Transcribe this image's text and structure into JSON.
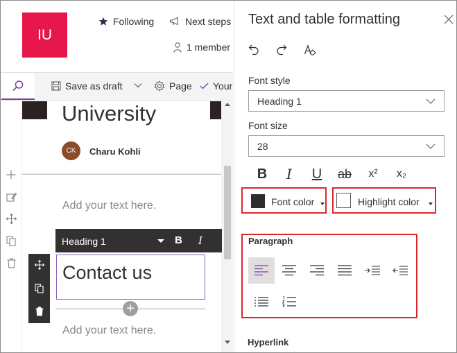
{
  "site": {
    "logo_initials": "IU",
    "following_label": "Following",
    "next_steps_label": "Next steps",
    "members_label": "1 member"
  },
  "commandbar": {
    "save_as_draft_label": "Save as draft",
    "page_label": "Page",
    "your_label": "Your"
  },
  "page": {
    "title": "University",
    "author_initials": "CK",
    "author_name": "Charu Kohli",
    "text_placeholder_1": "Add your text here.",
    "heading_text": "Contact us",
    "text_placeholder_2": "Add your text here."
  },
  "rte_toolbar": {
    "style_value": "Heading 1",
    "bold_label": "B",
    "italic_label": "I"
  },
  "panel": {
    "title": "Text and table formatting",
    "font_style_label": "Font style",
    "font_style_value": "Heading 1",
    "font_size_label": "Font size",
    "font_size_value": "28",
    "bold_label": "B",
    "italic_label": "I",
    "underline_label": "U",
    "strikethrough_label": "ab",
    "superscript_label": "x²",
    "subscript_label": "x₂",
    "font_color_label": "Font color",
    "highlight_color_label": "Highlight color",
    "paragraph_label": "Paragraph",
    "hyperlink_label": "Hyperlink"
  },
  "colors": {
    "logo_bg": "#e8174b",
    "highlight_border": "#d9272e",
    "accent": "#7b3fa0",
    "font_color_swatch": "#2d2d2d",
    "toolbar_bg": "#323130"
  },
  "icons": [
    "search-icon",
    "save-icon",
    "gear-icon",
    "check-icon",
    "star-icon",
    "megaphone-icon",
    "person-icon",
    "undo-icon",
    "redo-icon",
    "clear-format-icon",
    "close-icon",
    "plus-icon",
    "edit-icon",
    "move-icon",
    "copy-icon",
    "delete-icon"
  ]
}
